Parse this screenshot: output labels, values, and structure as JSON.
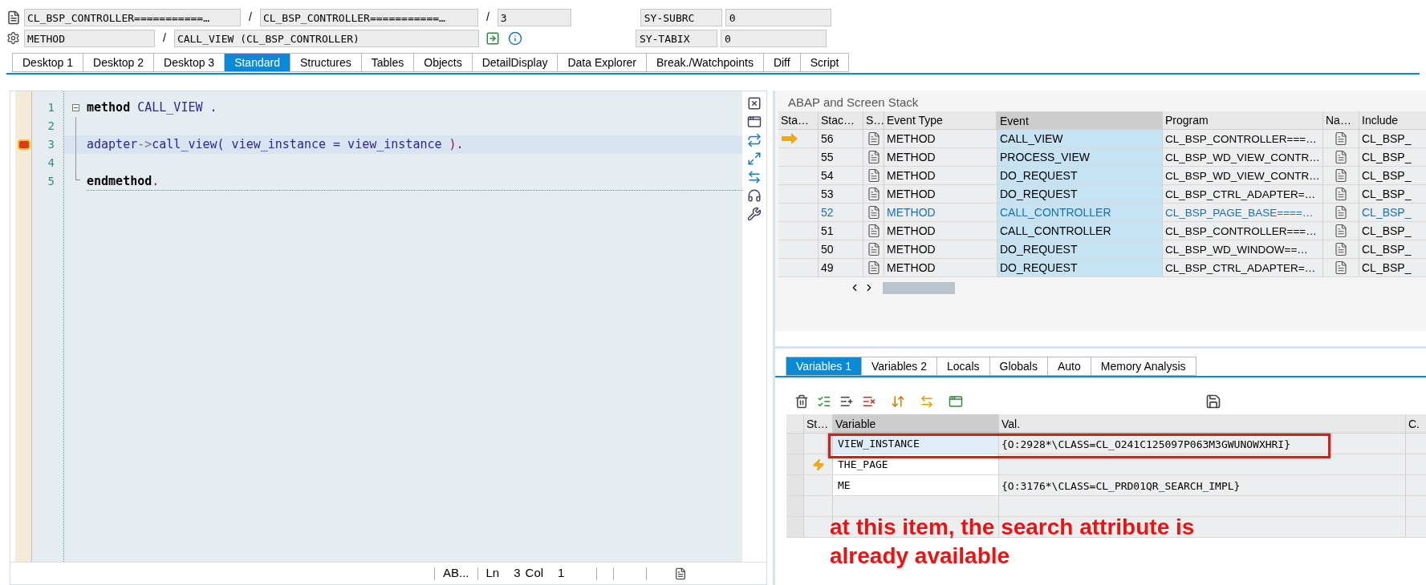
{
  "header": {
    "rows": [
      {
        "items": [
          {
            "kind": "field",
            "text": "CL_BSP_CONTROLLER===========…"
          },
          {
            "kind": "sep",
            "text": "/"
          },
          {
            "kind": "field",
            "text": "CL_BSP_CONTROLLER===========…"
          },
          {
            "kind": "sep",
            "text": "/"
          },
          {
            "kind": "field",
            "text": "3"
          }
        ],
        "sysvar": "SY-SUBRC",
        "sysval": "0"
      },
      {
        "items": [
          {
            "kind": "field",
            "text": "METHOD"
          },
          {
            "kind": "sep",
            "text": "/"
          },
          {
            "kind": "field",
            "text": "CALL_VIEW (CL_BSP_CONTROLLER)"
          }
        ],
        "sysvar": "SY-TABIX",
        "sysval": "0"
      }
    ]
  },
  "tabs": [
    {
      "label": "Desktop 1",
      "selected": false
    },
    {
      "label": "Desktop 2",
      "selected": false
    },
    {
      "label": "Desktop 3",
      "selected": false
    },
    {
      "label": "Standard",
      "selected": true
    },
    {
      "label": "Structures",
      "selected": false
    },
    {
      "label": "Tables",
      "selected": false
    },
    {
      "label": "Objects",
      "selected": false
    },
    {
      "label": "DetailDisplay",
      "selected": false
    },
    {
      "label": "Data Explorer",
      "selected": false
    },
    {
      "label": "Break./Watchpoints",
      "selected": false
    },
    {
      "label": "Diff",
      "selected": false
    },
    {
      "label": "Script",
      "selected": false
    }
  ],
  "editor": {
    "lines": [
      {
        "number": "1",
        "current": false,
        "breakpoint": false,
        "tokens": [
          {
            "kind": "keyword",
            "text": "method"
          },
          {
            "kind": "ident",
            "text": " CALL_VIEW ."
          }
        ]
      },
      {
        "number": "2",
        "current": false,
        "breakpoint": false
      },
      {
        "number": "3",
        "current": true,
        "breakpoint": true,
        "tokens": [
          {
            "kind": "ident",
            "text": "adapter"
          },
          {
            "kind": "op",
            "text": "->"
          },
          {
            "kind": "ident",
            "text": "call_view( view_instance = view_instance "
          },
          {
            "kind": "punct",
            "text": ")."
          }
        ]
      },
      {
        "number": "4",
        "current": false,
        "breakpoint": false
      },
      {
        "number": "5",
        "current": false,
        "breakpoint": false,
        "tokens": [
          {
            "kind": "keyword",
            "text": "endmethod"
          },
          {
            "kind": "punct",
            "text": "."
          }
        ]
      }
    ],
    "status_bar": [
      "AB...",
      "Ln",
      "3",
      "Col",
      "1"
    ]
  },
  "stack": {
    "title": "ABAP and Screen Stack",
    "columns": [
      {
        "label": "Sta…",
        "selected": false
      },
      {
        "label": "Stac…",
        "selected": false
      },
      {
        "label": "S…",
        "selected": false
      },
      {
        "label": "Event Type",
        "selected": false
      },
      {
        "label": "Event",
        "selected": true
      },
      {
        "label": "Program",
        "selected": false
      },
      {
        "label": "Na…",
        "selected": false
      },
      {
        "label": "Include",
        "selected": false
      }
    ],
    "rows": [
      {
        "current": true,
        "highlighted": false,
        "level": "56",
        "event_type": "METHOD",
        "event": "CALL_VIEW",
        "program": "CL_BSP_CONTROLLER===…",
        "include": "CL_BSP_"
      },
      {
        "current": false,
        "highlighted": false,
        "level": "55",
        "event_type": "METHOD",
        "event": "PROCESS_VIEW",
        "program": "CL_BSP_WD_VIEW_CONTR…",
        "include": "CL_BSP_"
      },
      {
        "current": false,
        "highlighted": false,
        "level": "54",
        "event_type": "METHOD",
        "event": "DO_REQUEST",
        "program": "CL_BSP_WD_VIEW_CONTR…",
        "include": "CL_BSP_"
      },
      {
        "current": false,
        "highlighted": false,
        "level": "53",
        "event_type": "METHOD",
        "event": "DO_REQUEST",
        "program": "CL_BSP_CTRL_ADAPTER=…",
        "include": "CL_BSP_"
      },
      {
        "current": false,
        "highlighted": true,
        "level": "52",
        "event_type": "METHOD",
        "event": "CALL_CONTROLLER",
        "program": "CL_BSP_PAGE_BASE====…",
        "include": "CL_BSP_"
      },
      {
        "current": false,
        "highlighted": false,
        "level": "51",
        "event_type": "METHOD",
        "event": "CALL_CONTROLLER",
        "program": "CL_BSP_CONTROLLER===…",
        "include": "CL_BSP_"
      },
      {
        "current": false,
        "highlighted": false,
        "level": "50",
        "event_type": "METHOD",
        "event": "DO_REQUEST",
        "program": "CL_BSP_WD_WINDOW==…",
        "include": "CL_BSP_"
      },
      {
        "current": false,
        "highlighted": false,
        "level": "49",
        "event_type": "METHOD",
        "event": "DO_REQUEST",
        "program": "CL_BSP_CTRL_ADAPTER=…",
        "include": "CL_BSP_"
      }
    ]
  },
  "variables": {
    "tabs": [
      {
        "label": "Variables 1",
        "selected": true
      },
      {
        "label": "Variables 2",
        "selected": false
      },
      {
        "label": "Locals",
        "selected": false
      },
      {
        "label": "Globals",
        "selected": false
      },
      {
        "label": "Auto",
        "selected": false
      },
      {
        "label": "Memory Analysis",
        "selected": false
      }
    ],
    "columns": [
      {
        "label": "St…",
        "selected": false
      },
      {
        "label": "Variable",
        "selected": true
      },
      {
        "label": "Val.",
        "selected": false
      },
      {
        "label": "C.",
        "selected": false
      }
    ],
    "rows": [
      {
        "name": "VIEW_INSTANCE",
        "value": "{O:2928*\\CLASS=CL_O241C125097P063M3GWUNOWXHRI}",
        "changed": false,
        "selected": true
      },
      {
        "name": "THE_PAGE",
        "changed": true,
        "selected": false
      },
      {
        "name": "ME",
        "value": "{O:3176*\\CLASS=CL_PRD01QR_SEARCH_IMPL}",
        "changed": false,
        "selected": false
      }
    ]
  },
  "annotation": {
    "text": "at this item, the search attribute is already available"
  }
}
